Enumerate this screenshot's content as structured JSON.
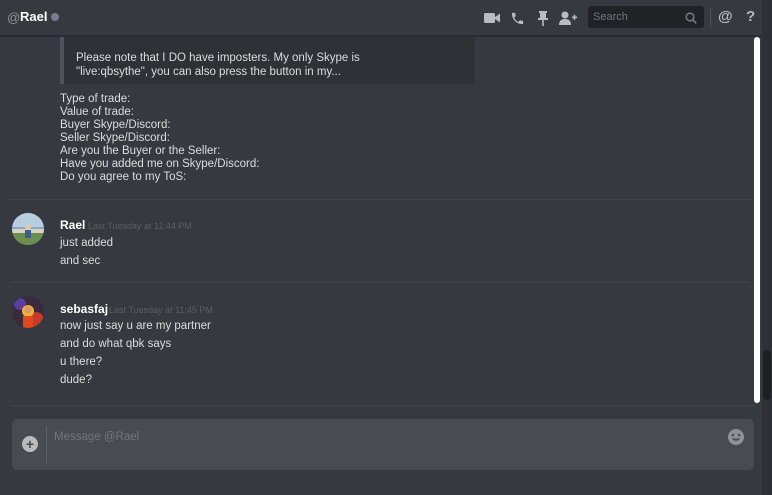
{
  "header": {
    "at_symbol": "@",
    "channel_name": "Rael",
    "search_placeholder": "Search",
    "mention_button": "@",
    "help_button": "?"
  },
  "embed": {
    "lines": [
      "Please note that I DO have imposters. My only Skype is",
      "\"live:qbsythe\", you can also press the button in my..."
    ]
  },
  "form_lines": [
    "Type of trade:",
    "Value of trade:",
    "Buyer Skype/Discord:",
    "Seller Skype/Discord:",
    "Are you the Buyer or the Seller:",
    "Have you added me on Skype/Discord:",
    "Do you agree to my ToS:"
  ],
  "messages": [
    {
      "author": "Rael",
      "timestamp": "Last Tuesday at 11:44 PM",
      "lines": [
        "just added",
        "and sec"
      ]
    },
    {
      "author": "sebasfaj",
      "timestamp": "Last Tuesday at 11:45 PM",
      "lines": [
        "now just say u are my partner",
        "and do what qbk says",
        "u there?",
        "dude?"
      ]
    }
  ],
  "composer": {
    "placeholder": "Message @Rael"
  },
  "icons": {
    "video": "video-call-icon",
    "phone": "voice-call-icon",
    "pin": "pin-icon",
    "add_friend": "add-friend-icon",
    "search": "search-icon",
    "plus": "upload-plus-icon",
    "emoji": "emoji-icon"
  },
  "colors": {
    "background": "#36393f",
    "embed_bg": "#2f3136",
    "input_bg": "#484b51",
    "text": "#dcddde",
    "muted": "#72767d"
  }
}
